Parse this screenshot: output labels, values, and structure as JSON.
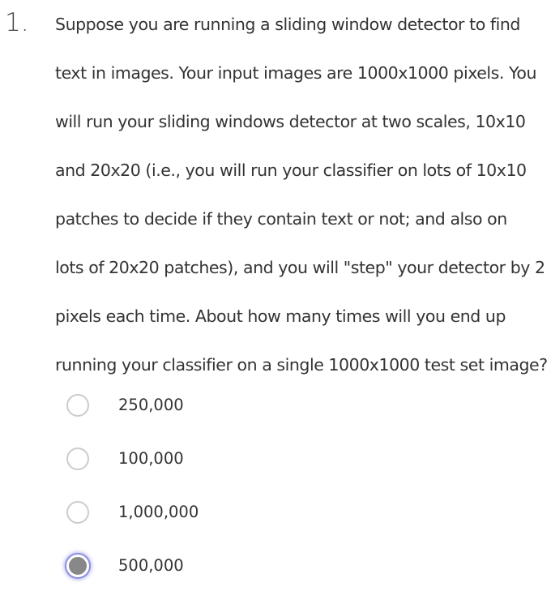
{
  "question": {
    "number": "1.",
    "lines": [
      "Suppose you are running a sliding window detector to find",
      "text in images. Your input images are 1000x1000 pixels. You",
      "will run your sliding windows detector at two scales, 10x10",
      "and 20x20 (i.e., you will run your classifier on lots of 10x10",
      "patches to decide if they contain text or not; and also on",
      "lots of 20x20 patches), and you will \"step\" your detector by 2",
      "pixels each time. About how many times will you end up",
      "running your classifier on a single 1000x1000 test set image?"
    ]
  },
  "options": [
    {
      "label": "250,000",
      "selected": false
    },
    {
      "label": "100,000",
      "selected": false
    },
    {
      "label": "1,000,000",
      "selected": false
    },
    {
      "label": "500,000",
      "selected": true
    }
  ]
}
